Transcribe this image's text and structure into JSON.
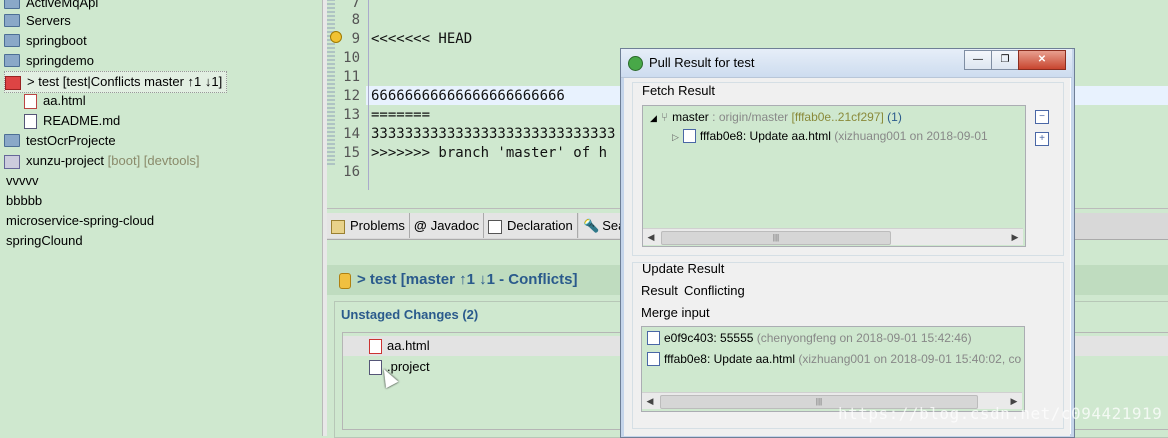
{
  "explorer": {
    "items": [
      {
        "label": "ActiveMqApi",
        "extra": ""
      },
      {
        "label": "Servers",
        "extra": ""
      },
      {
        "label": "springboot",
        "extra": ""
      },
      {
        "label": "springdemo",
        "extra": ""
      },
      {
        "label": "> test [test|Conflicts master ↑1 ↓1]",
        "extra": ""
      },
      {
        "label": "aa.html",
        "extra": ""
      },
      {
        "label": "README.md",
        "extra": ""
      },
      {
        "label": "testOcrProjecte",
        "extra": ""
      },
      {
        "label": "xunzu-project",
        "extra": "[boot] [devtools]"
      },
      {
        "label": "vvvvv",
        "extra": ""
      },
      {
        "label": "bbbbb",
        "extra": ""
      },
      {
        "label": "microservice-spring-cloud",
        "extra": ""
      },
      {
        "label": "springClound",
        "extra": ""
      }
    ]
  },
  "editor": {
    "lines": [
      {
        "num": "7",
        "text": ""
      },
      {
        "num": "8",
        "text": ""
      },
      {
        "num": "9",
        "text": "<<<<<<< HEAD"
      },
      {
        "num": "10",
        "text": ""
      },
      {
        "num": "11",
        "text": ""
      },
      {
        "num": "12",
        "text": "66666666666666666666666"
      },
      {
        "num": "13",
        "text": "======="
      },
      {
        "num": "14",
        "text": "33333333333333333333333333333"
      },
      {
        "num": "15",
        "text": ">>>>>>> branch 'master' of h"
      },
      {
        "num": "16",
        "text": ""
      }
    ]
  },
  "tabs": {
    "problems": "Problems",
    "javadoc": "Javadoc",
    "declaration": "Declaration",
    "search": "Sea"
  },
  "staging": {
    "title": "> test [master ↑1 ↓1 - Conflicts]",
    "unstaged_label": "Unstaged Changes (2)",
    "files": [
      "aa.html",
      ".project"
    ]
  },
  "dialog": {
    "title": "Pull Result for test",
    "fetch_label": "Fetch Result",
    "fetch_branch": "master",
    "fetch_remote": " : origin/master",
    "fetch_range": " [fffab0e..21cf297]",
    "fetch_count": " (1)",
    "fetch_commit": "fffab0e8: Update aa.html",
    "fetch_commit_meta": " (xizhuang001 on 2018-09-01",
    "update_label": "Update Result",
    "result_label": "Result",
    "result_value": "Conflicting",
    "merge_label": "Merge input",
    "merge_items": [
      {
        "msg": "e0f9c403: 55555",
        "meta": " (chenyongfeng on 2018-09-01 15:42:46)"
      },
      {
        "msg": "fffab0e8: Update aa.html",
        "meta": " (xizhuang001 on 2018-09-01 15:40:02, co"
      }
    ],
    "btn_minimize": "—",
    "btn_restore": "❐",
    "btn_close": "✕"
  },
  "watermark": "https://blog.csdn.net/c094421919",
  "colors": {
    "accent": "#2a5a8c",
    "background": "#cfe8cf"
  }
}
